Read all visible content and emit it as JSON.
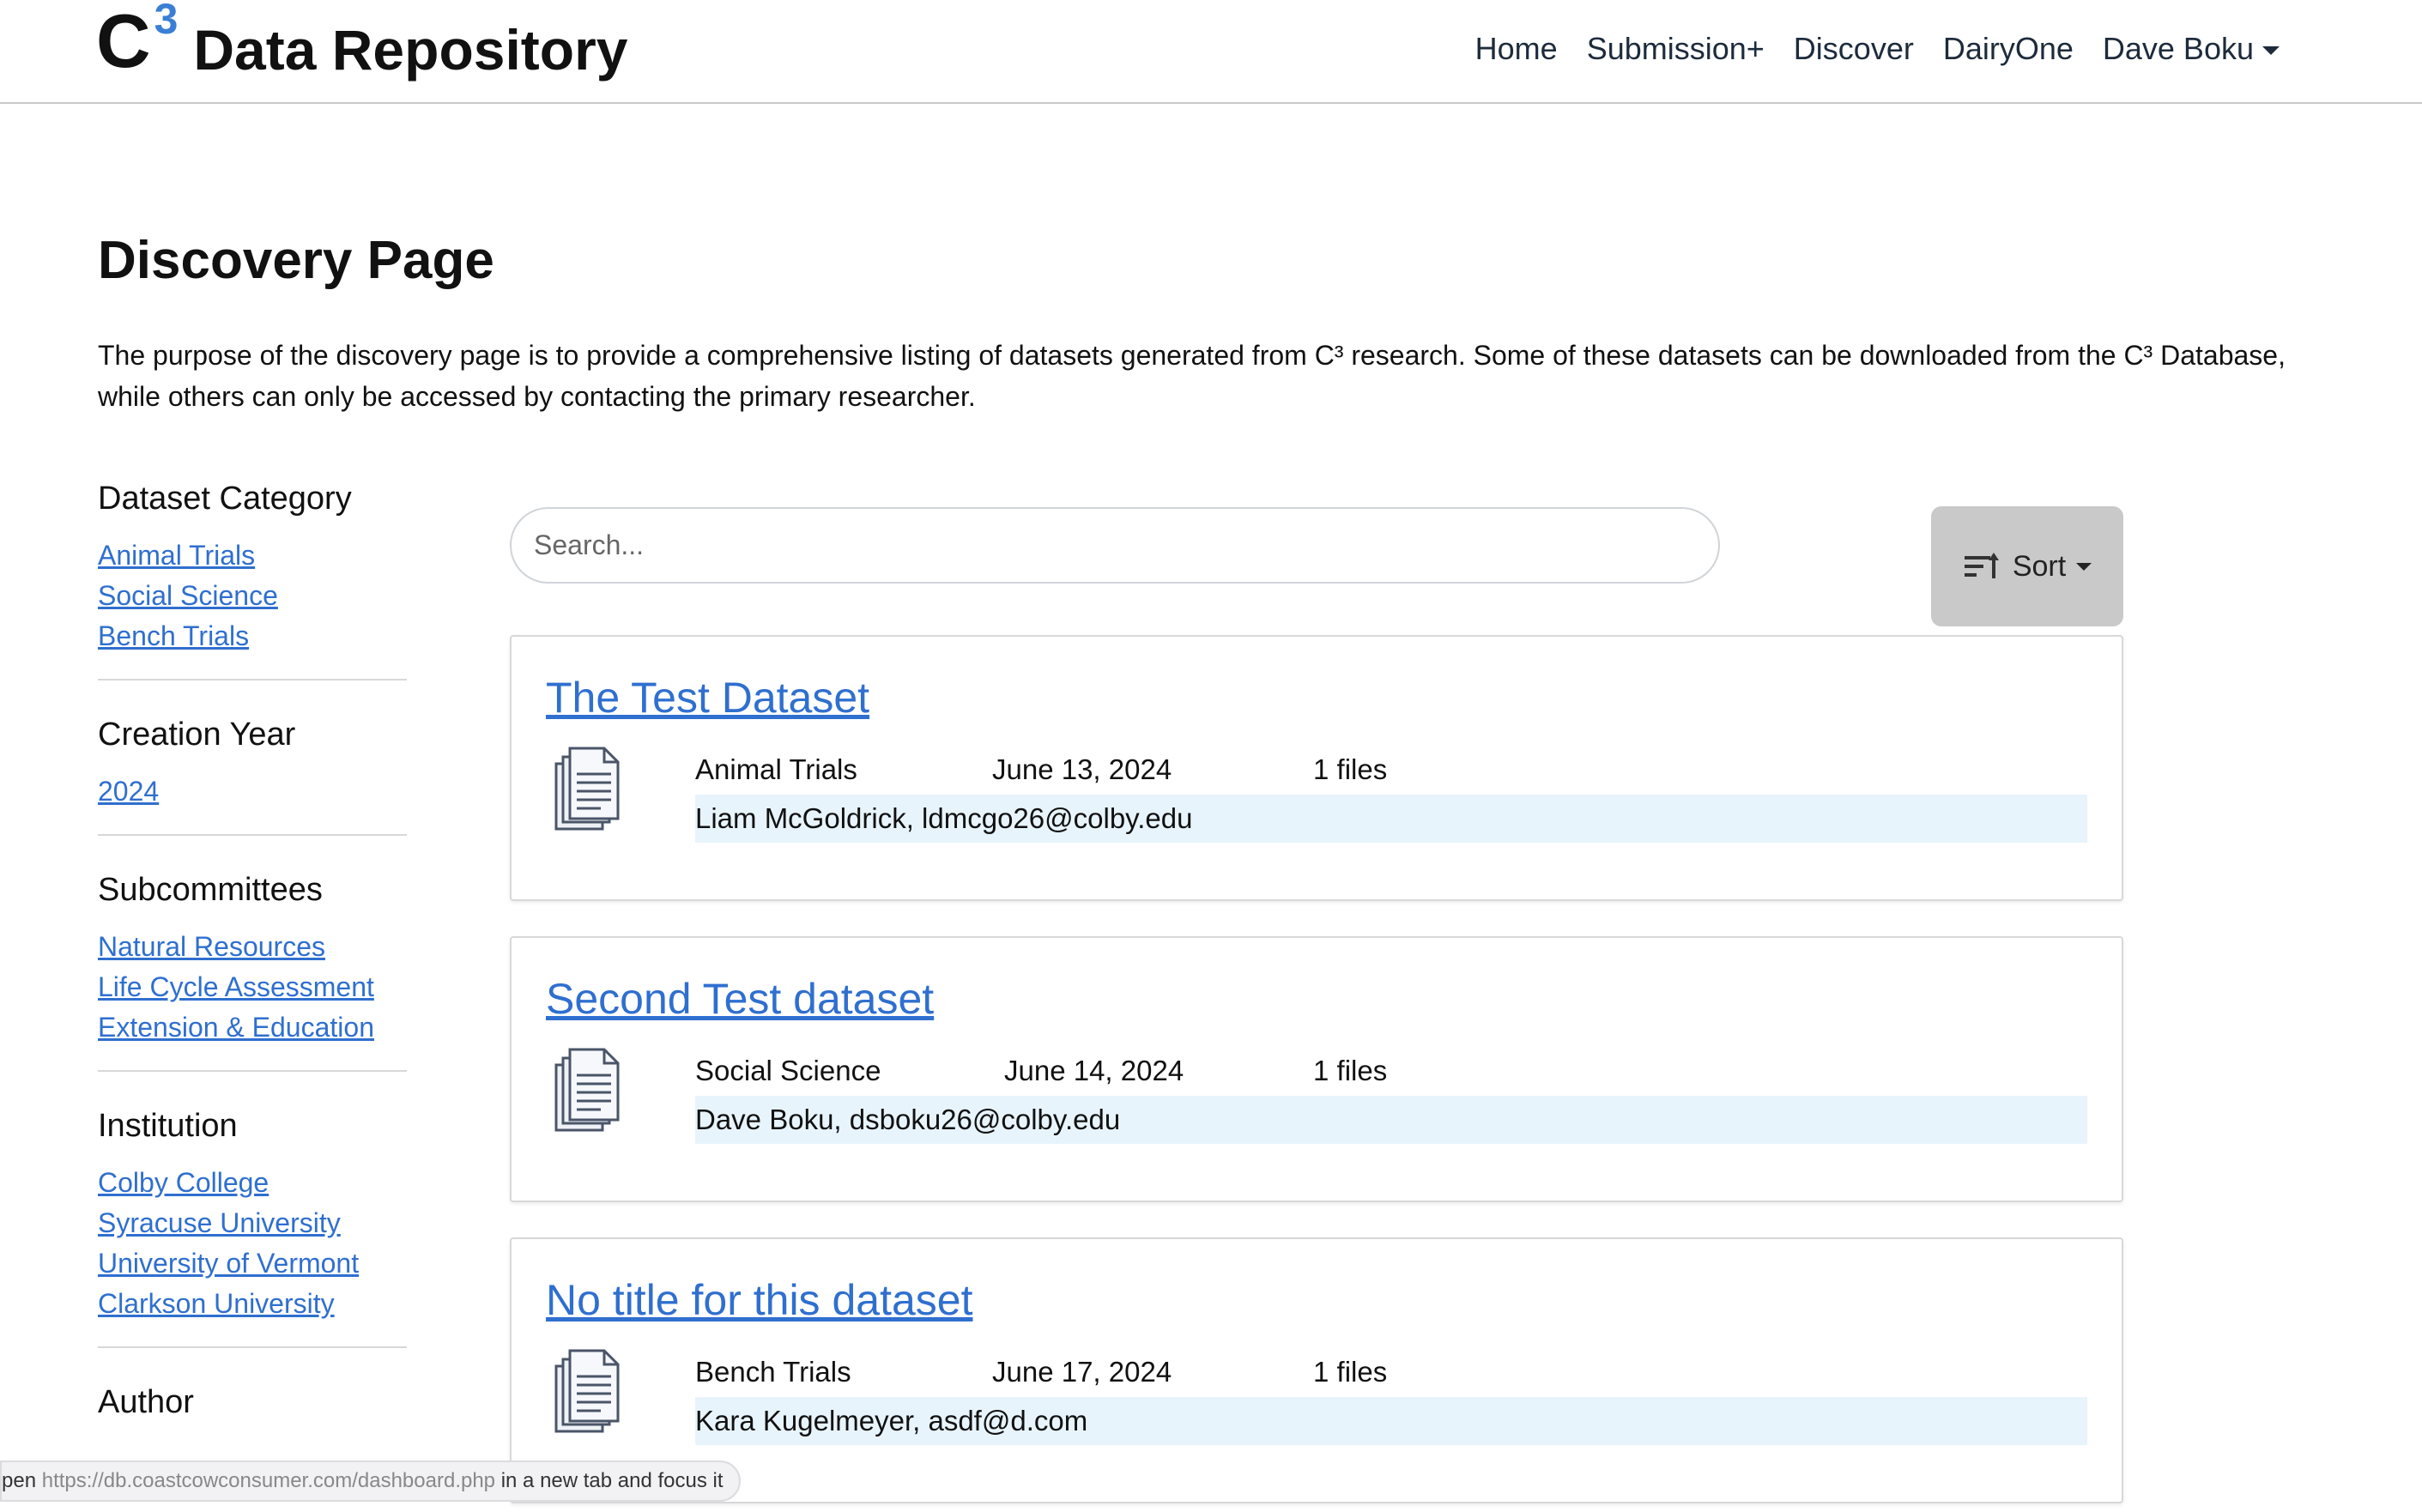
{
  "brand": {
    "letter": "C",
    "superscript": "3",
    "name": "Data Repository"
  },
  "nav": {
    "items": [
      "Home",
      "Submission+",
      "Discover",
      "DairyOne"
    ],
    "user": "Dave Boku"
  },
  "page": {
    "title": "Discovery Page",
    "intro": "The purpose of the discovery page is to provide a comprehensive listing of datasets generated from C³ research. Some of these datasets can be downloaded from the C³ Database, while others can only be accessed by contacting the primary researcher."
  },
  "sidebar": {
    "sections": [
      {
        "title": "Dataset Category",
        "links": [
          "Animal Trials",
          "Social Science",
          "Bench Trials"
        ]
      },
      {
        "title": "Creation Year",
        "links": [
          "2024"
        ]
      },
      {
        "title": "Subcommittees",
        "links": [
          "Natural Resources",
          "Life Cycle Assessment",
          "Extension & Education"
        ]
      },
      {
        "title": "Institution",
        "links": [
          "Colby College",
          "Syracuse University",
          "University of Vermont",
          "Clarkson University"
        ]
      },
      {
        "title": "Author",
        "links": []
      }
    ]
  },
  "search": {
    "placeholder": "Search..."
  },
  "sort": {
    "label": "Sort"
  },
  "datasets": [
    {
      "title": "The Test Dataset",
      "category": "Animal Trials",
      "date": "June 13, 2024",
      "files": "1 files",
      "author": "Liam McGoldrick, ldmcgo26@colby.edu"
    },
    {
      "title": "Second Test dataset",
      "category": "Social Science",
      "date": "June 14, 2024",
      "files": "1 files",
      "author": "Dave Boku, dsboku26@colby.edu"
    },
    {
      "title": "No title for this dataset",
      "category": "Bench Trials",
      "date": "June 17, 2024",
      "files": "1 files",
      "author": "Kara Kugelmeyer, asdf@d.com"
    }
  ],
  "status_bar": {
    "prefix": "pen ",
    "url": "https://db.coastcowconsumer.com/dashboard.php",
    "suffix": " in a new tab and focus it"
  }
}
